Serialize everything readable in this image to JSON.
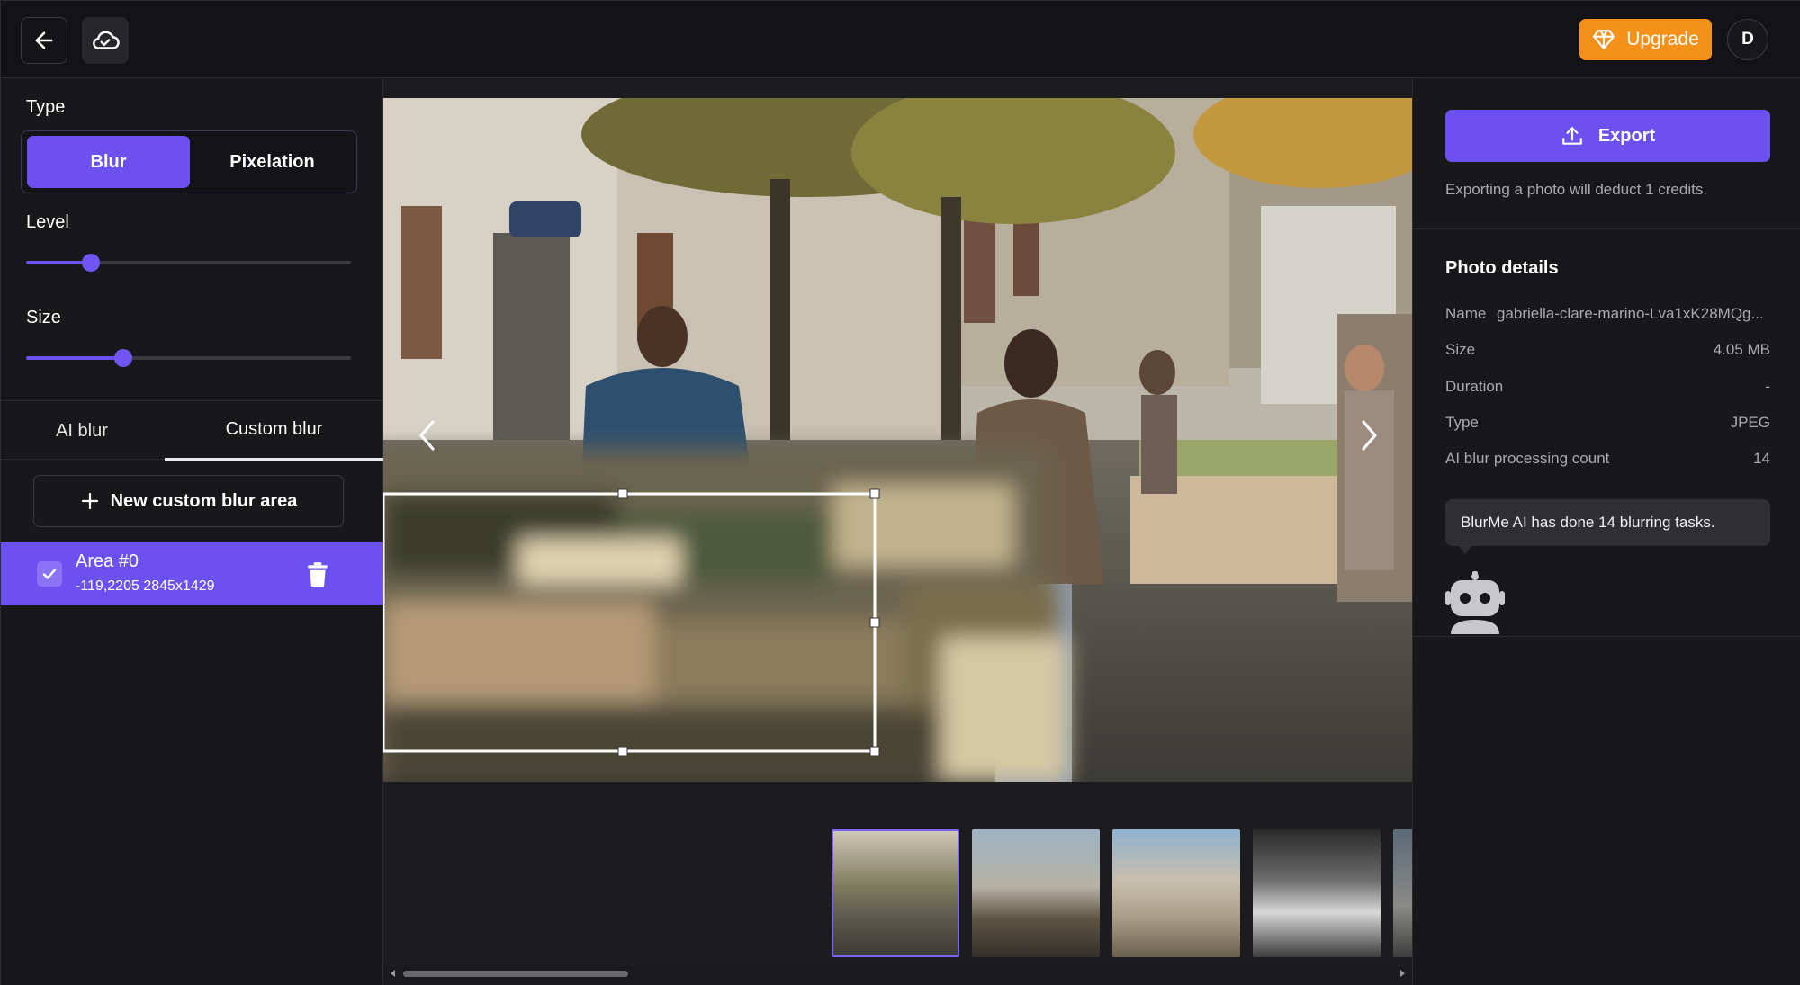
{
  "header": {
    "upgrade_label": "Upgrade",
    "avatar_initial": "D"
  },
  "left_panel": {
    "type_label": "Type",
    "type_options": [
      "Blur",
      "Pixelation"
    ],
    "type_selected": "Blur",
    "level_label": "Level",
    "level_value_fraction": 0.2,
    "size_label": "Size",
    "size_value_fraction": 0.3,
    "mode_tabs": [
      "AI blur",
      "Custom blur"
    ],
    "mode_selected": "Custom blur",
    "new_area_label": "New custom blur area",
    "areas": [
      {
        "name": "Area #0",
        "coords": "-119,2205 2845x1429",
        "checked": true
      }
    ]
  },
  "right_panel": {
    "export_label": "Export",
    "export_note": "Exporting a photo will deduct 1 credits.",
    "details_title": "Photo details",
    "details": [
      {
        "key": "Name",
        "value": "gabriella-clare-marino-Lva1xK28MQg..."
      },
      {
        "key": "Size",
        "value": "4.05 MB"
      },
      {
        "key": "Duration",
        "value": "-"
      },
      {
        "key": "Type",
        "value": "JPEG"
      },
      {
        "key": "AI blur processing count",
        "value": "14"
      }
    ],
    "ai_bubble": "BlurMe AI has done 14 blurring tasks."
  },
  "colors": {
    "accent": "#6c50f0",
    "upgrade": "#f4911a",
    "background": "#151518"
  },
  "icons": {
    "back": "arrow-left-icon",
    "cloud": "cloud-check-icon",
    "upgrade": "diamond-icon",
    "add": "plus-icon",
    "check": "check-icon",
    "delete": "trash-icon",
    "export": "upload-icon",
    "prev": "chevron-left-icon",
    "next": "chevron-right-icon",
    "robot": "robot-icon"
  }
}
